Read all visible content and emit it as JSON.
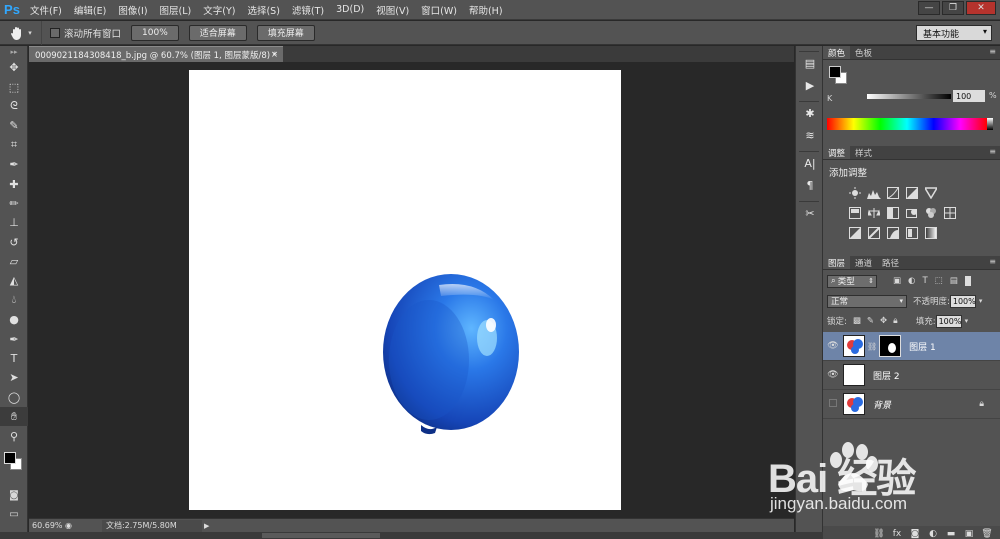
{
  "app": {
    "logo": "Ps"
  },
  "menu": [
    "文件(F)",
    "编辑(E)",
    "图像(I)",
    "图层(L)",
    "文字(Y)",
    "选择(S)",
    "滤镜(T)",
    "3D(D)",
    "视图(V)",
    "窗口(W)",
    "帮助(H)"
  ],
  "window_buttons": {
    "minimize": "—",
    "restore": "❐",
    "close": "✕"
  },
  "options": {
    "scroll_all_windows": "滚动所有窗口",
    "btn_100": "100%",
    "btn_fit": "适合屏幕",
    "btn_fill": "填充屏幕",
    "workspace": "基本功能"
  },
  "document": {
    "tab_title": "0009021184308418_b.jpg @ 60.7% (图层 1, 图层蒙版/8) *",
    "close": "×"
  },
  "status": {
    "zoom": "60.69%",
    "doc": "文档:2.75M/5.80M",
    "arrow": "▶"
  },
  "tools": [
    "move-tool",
    "marquee-tool",
    "lasso-tool",
    "quick-select-tool",
    "crop-tool",
    "eyedropper-tool",
    "healing-brush-tool",
    "brush-tool",
    "clone-stamp-tool",
    "history-brush-tool",
    "eraser-tool",
    "paint-bucket-tool",
    "blur-tool",
    "dodge-tool",
    "pen-tool",
    "type-tool",
    "path-select-tool",
    "ellipse-tool",
    "hand-tool",
    "zoom-tool"
  ],
  "active_tool": "hand-tool",
  "panels": {
    "color": {
      "tab1": "颜色",
      "tab2": "色板",
      "k_label": "K",
      "k_value": "100",
      "pct": "%"
    },
    "adjustments": {
      "tab1": "调整",
      "tab2": "样式",
      "title": "添加调整"
    },
    "layers": {
      "tab1": "图层",
      "tab2": "通道",
      "tab3": "路径",
      "filter": "类型",
      "blend": "正常",
      "opacity_label": "不透明度:",
      "opacity": "100%",
      "lock_label": "锁定:",
      "fill_label": "填充:",
      "fill": "100%",
      "items": [
        {
          "name": "图层 1",
          "visible": true,
          "selected": true,
          "has_mask": true
        },
        {
          "name": "图层 2",
          "visible": true,
          "selected": false,
          "has_mask": false
        },
        {
          "name": "背景",
          "visible": false,
          "selected": false,
          "has_mask": false,
          "locked": true
        }
      ]
    }
  },
  "watermark": {
    "brand": "Bai 经验",
    "url": "jingyan.baidu.com"
  },
  "colors": {
    "accent": "#31a8ff",
    "selected_layer": "#6e84a8",
    "balloon": "#1e63d6"
  }
}
